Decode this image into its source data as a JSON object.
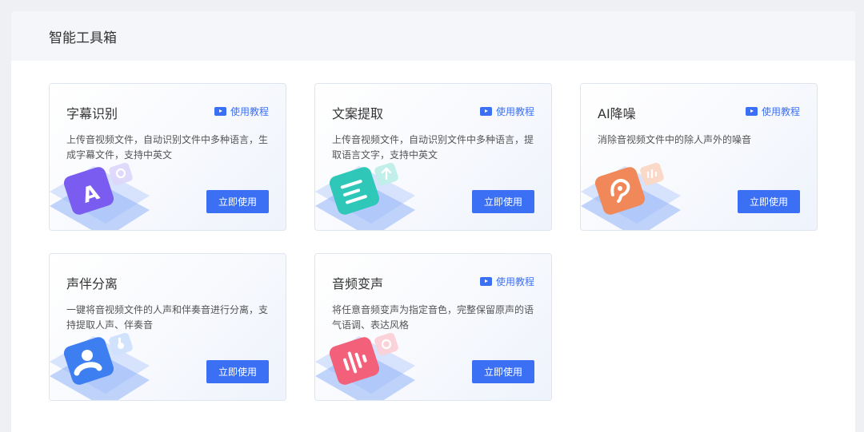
{
  "page": {
    "title": "智能工具箱"
  },
  "cards": [
    {
      "title": "字幕识别",
      "tutorial_label": "使用教程",
      "has_tutorial": true,
      "description": "上传音视频文件，自动识别文件中多种语言，生成字幕文件，支持中英文",
      "button_label": "立即使用",
      "icon": "letter-a-icon",
      "color": "#7a5cf0"
    },
    {
      "title": "文案提取",
      "tutorial_label": "使用教程",
      "has_tutorial": true,
      "description": "上传音视频文件，自动识别文件中多种语言，提取语言文字，支持中英文",
      "button_label": "立即使用",
      "icon": "text-lines-icon",
      "color": "#2fc7b7"
    },
    {
      "title": "AI降噪",
      "tutorial_label": "使用教程",
      "has_tutorial": true,
      "description": "消除音视频文件中的除人声外的噪音",
      "button_label": "立即使用",
      "icon": "ear-icon",
      "color": "#f0885a"
    },
    {
      "title": "声伴分离",
      "tutorial_label": "",
      "has_tutorial": false,
      "description": "一键将音视频文件的人声和伴奏音进行分离，支持提取人声、伴奏音",
      "button_label": "立即使用",
      "icon": "person-icon",
      "color": "#3d7ef0"
    },
    {
      "title": "音频变声",
      "tutorial_label": "使用教程",
      "has_tutorial": true,
      "description": "将任意音频变声为指定音色，完整保留原声的语气语调、表达风格",
      "button_label": "立即使用",
      "icon": "sound-wave-icon",
      "color": "#f2607a"
    }
  ]
}
